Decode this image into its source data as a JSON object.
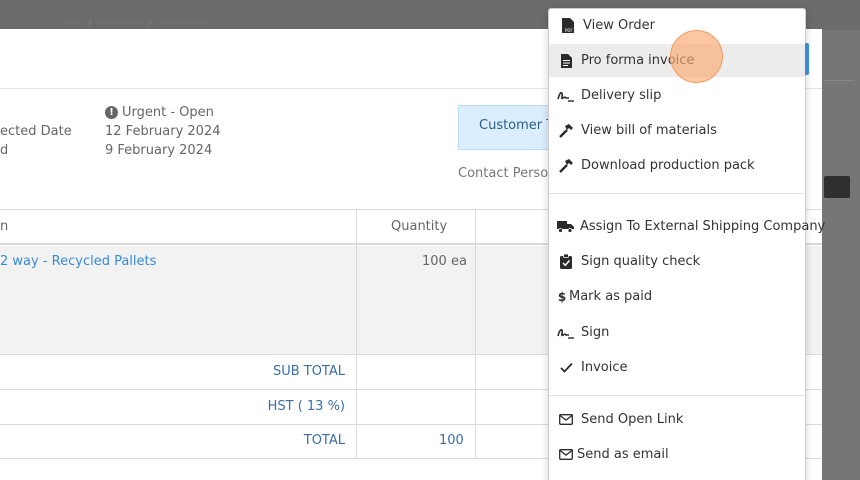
{
  "background": {
    "breadcrumbs": "······  /  ············  /  ··············"
  },
  "order": {
    "status": "Urgent - Open",
    "left_labels": [
      "ected Date",
      "d"
    ],
    "dates": [
      "12 February 2024",
      "9 February 2024"
    ],
    "customer_box": "Customer T",
    "contact_label": "Contact Person"
  },
  "table": {
    "header_first": "n",
    "header_quantity": "Quantity",
    "item": {
      "name": "2 way - Recycled Pallets",
      "quantity": "100 ea"
    },
    "summary": [
      {
        "label": "SUB TOTAL",
        "value": ""
      },
      {
        "label": "HST ( 13 %)",
        "value": ""
      },
      {
        "label": "TOTAL",
        "value": "100"
      }
    ]
  },
  "dropdown": {
    "items": [
      {
        "label": "View Order",
        "icon": "pdf-file-icon"
      },
      {
        "label": "Pro forma invoice",
        "icon": "document-icon"
      },
      {
        "label": "Delivery slip",
        "icon": "signature-icon"
      },
      {
        "label": "View bill of materials",
        "icon": "hammer-icon"
      },
      {
        "label": "Download production pack",
        "icon": "hammer-icon"
      },
      {
        "label": "Assign To External Shipping Company",
        "icon": "truck-icon"
      },
      {
        "label": "Sign quality check",
        "icon": "clipboard-check-icon"
      },
      {
        "label": "Mark as paid",
        "icon": "dollar-icon"
      },
      {
        "label": "Sign",
        "icon": "signature-icon"
      },
      {
        "label": "Invoice",
        "icon": "check-icon"
      },
      {
        "label": "Send Open Link",
        "icon": "envelope-icon"
      },
      {
        "label": "Send as email",
        "icon": "envelope-icon"
      }
    ]
  },
  "colors": {
    "link": "#3a8ad6",
    "summary_text": "#3a6ea5",
    "customer_box_bg": "#dbeeff",
    "click_indicator": "#fcaa6e"
  }
}
